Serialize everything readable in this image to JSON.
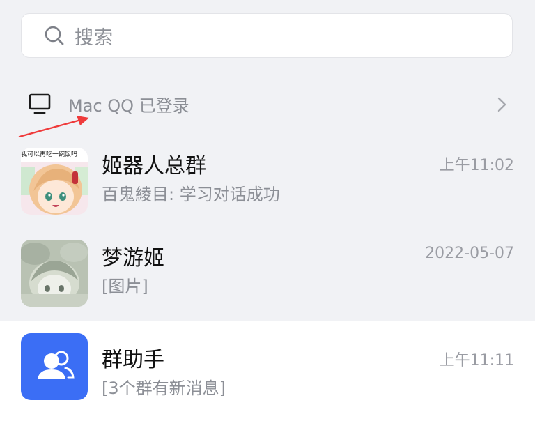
{
  "search": {
    "placeholder": "搜索"
  },
  "login_status": {
    "text": "Mac QQ 已登录",
    "icon": "monitor-icon"
  },
  "chats": [
    {
      "name": "姬器人总群",
      "preview": "百鬼綾目: 学习对话成功",
      "time": "上午11:02",
      "avatar_caption": "我可以再吃一碗饭吗",
      "avatar_icon": "anime-girl-avatar"
    },
    {
      "name": "梦游姬",
      "preview": "[图片]",
      "time": "2022-05-07",
      "avatar_icon": "anime-girl-sleeping-avatar"
    },
    {
      "name": "群助手",
      "preview": "[3个群有新消息]",
      "time": "上午11:11",
      "avatar_icon": "group-helper-icon"
    }
  ],
  "colors": {
    "background": "#f1f2f5",
    "accent": "#3b6ef5",
    "annotation": "#ef3b3b"
  }
}
